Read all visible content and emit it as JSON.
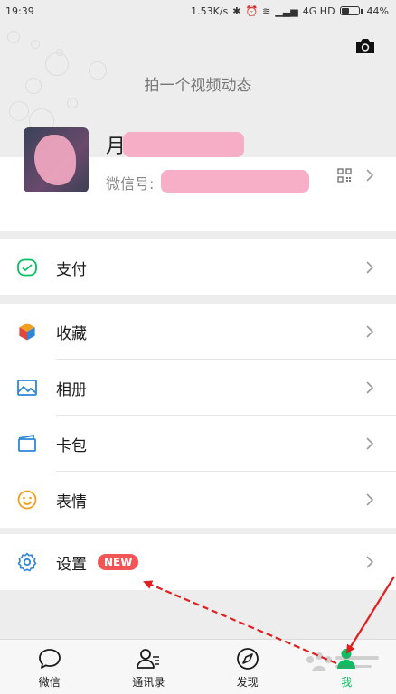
{
  "status_bar": {
    "time": "19:39",
    "net_speed": "1.53K/s",
    "network": "4G HD",
    "battery": "44%",
    "battery_level": 0.44
  },
  "moments": {
    "hint": "拍一个视频动态",
    "camera_icon": "camera-icon"
  },
  "profile": {
    "nickname": "月",
    "wechat_id_label": "微信号:",
    "qr_icon": "qr-code-icon"
  },
  "menu": {
    "pay": {
      "label": "支付",
      "icon": "wallet-icon",
      "color": "#07c160"
    },
    "favorites": {
      "label": "收藏",
      "icon": "cube-icon"
    },
    "album": {
      "label": "相册",
      "icon": "image-icon",
      "color": "#2f86d6"
    },
    "cards": {
      "label": "卡包",
      "icon": "card-icon",
      "color": "#2f86d6"
    },
    "stickers": {
      "label": "表情",
      "icon": "smile-icon",
      "color": "#f0a020"
    },
    "settings": {
      "label": "设置",
      "icon": "gear-icon",
      "color": "#2f86d6",
      "badge": "NEW",
      "badge_color": "#f25555"
    }
  },
  "tabs": [
    {
      "label": "微信",
      "icon": "chat-icon"
    },
    {
      "label": "通讯录",
      "icon": "contacts-icon"
    },
    {
      "label": "发现",
      "icon": "compass-icon"
    },
    {
      "label": "我",
      "icon": "me-icon",
      "active": true
    }
  ],
  "colors": {
    "accent": "#07c160",
    "annotation": "#e02020",
    "redaction": "#f6a6c1"
  }
}
